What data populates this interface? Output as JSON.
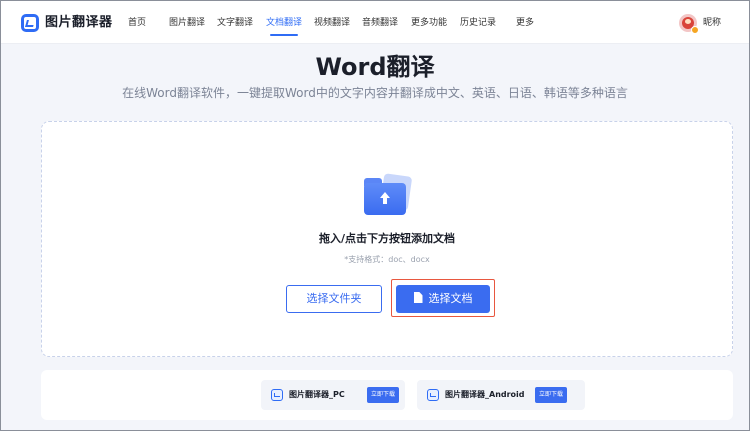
{
  "header": {
    "brand": "图片翻译器",
    "nav": [
      {
        "label": "首页",
        "active": false
      },
      {
        "label": "图片翻译",
        "active": false
      },
      {
        "label": "文字翻译",
        "active": false
      },
      {
        "label": "文档翻译",
        "active": true
      },
      {
        "label": "视频翻译",
        "active": false
      },
      {
        "label": "音频翻译",
        "active": false
      },
      {
        "label": "更多功能",
        "active": false
      },
      {
        "label": "历史记录",
        "active": false
      },
      {
        "label": "更多",
        "active": false
      }
    ],
    "user": {
      "nickname": "昵称"
    }
  },
  "hero": {
    "title": "Word翻译",
    "subtitle": "在线Word翻译软件，一键提取Word中的文字内容并翻译成中文、英语、日语、韩语等多种语言"
  },
  "upload": {
    "prompt": "拖入/点击下方按钮添加文档",
    "formats": "*支持格式：doc、docx",
    "select_folder_label": "选择文件夹",
    "select_document_label": "选择文档"
  },
  "downloads": [
    {
      "name": "图片翻译器_PC",
      "button": "立即下载"
    },
    {
      "name": "图片翻译器_Android",
      "button": "立即下载"
    }
  ],
  "colors": {
    "accent": "#3a6cf0",
    "highlight_outline": "#e8573f",
    "background": "#f3f5fa"
  }
}
